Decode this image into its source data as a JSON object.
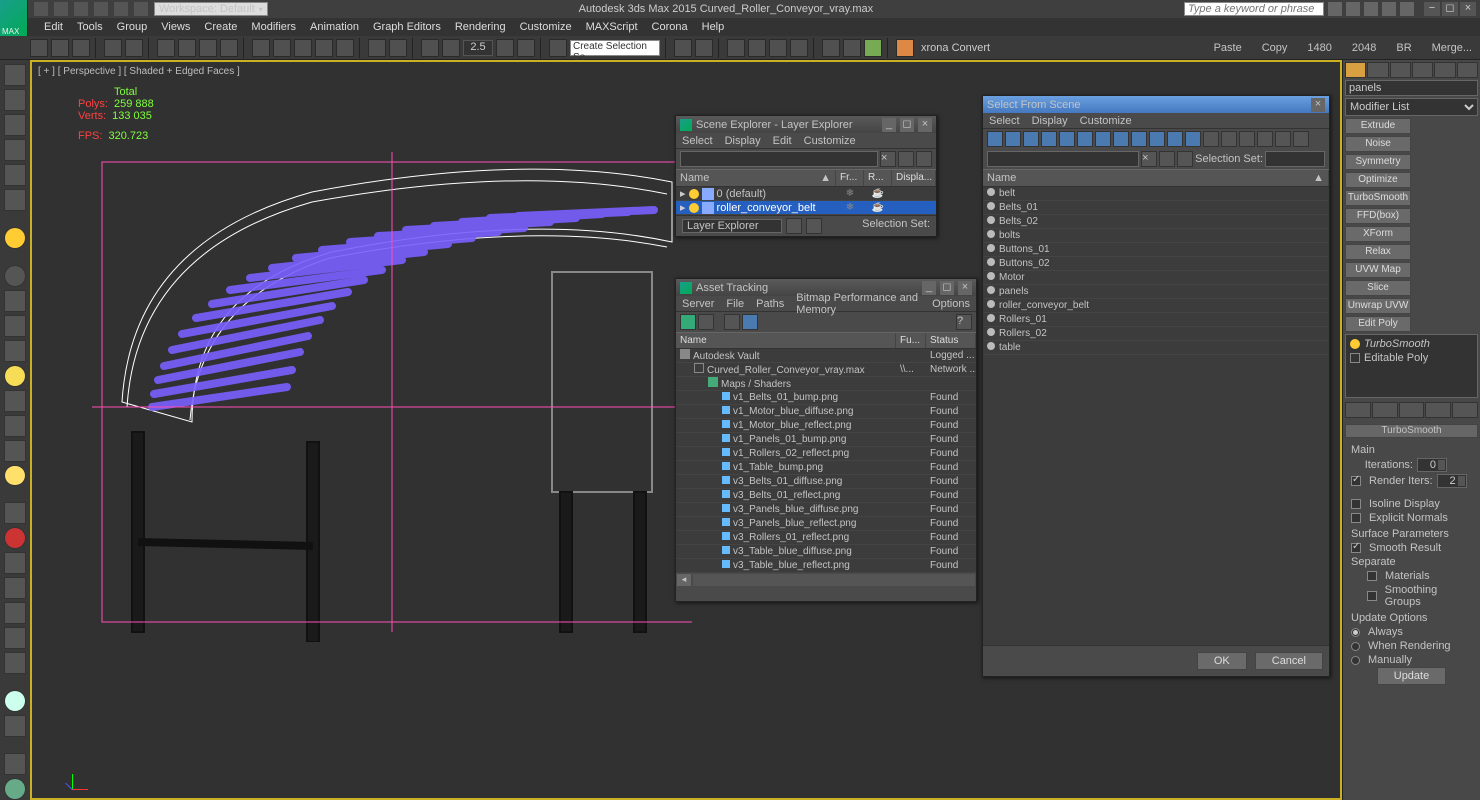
{
  "title_center": "Autodesk 3ds Max 2015     Curved_Roller_Conveyor_vray.max",
  "workspace_combo": "Workspace: Default",
  "search_placeholder": "Type a keyword or phrase",
  "menubar": [
    "Edit",
    "Tools",
    "Group",
    "Views",
    "Create",
    "Modifiers",
    "Animation",
    "Graph Editors",
    "Rendering",
    "Customize",
    "MAXScript",
    "Corona",
    "Help"
  ],
  "toolbar": {
    "spin_val": "2.5",
    "combo": "Create Selection Se",
    "info": [
      "xrona Convert",
      "Paste",
      "Copy",
      "1480",
      "2048",
      "BR",
      "Merge..."
    ]
  },
  "viewport_label": "[ + ] [ Perspective ] [ Shaded + Edged Faces ]",
  "stats": {
    "label_total": "Total",
    "polys_k": "Polys:",
    "polys_v": "259 888",
    "verts_k": "Verts:",
    "verts_v": "133 035",
    "fps_k": "FPS:",
    "fps_v": "320.723"
  },
  "scene_explorer": {
    "title": "Scene Explorer - Layer Explorer",
    "menus": [
      "Select",
      "Display",
      "Edit",
      "Customize"
    ],
    "headers": {
      "name": "Name",
      "fr": "Fr...",
      "r": "R...",
      "disp": "Displa..."
    },
    "rows": [
      {
        "name": "0 (default)",
        "type": "layer",
        "sel": false
      },
      {
        "name": "roller_conveyor_belt",
        "type": "layer",
        "sel": true
      }
    ],
    "footer_combo": "Layer Explorer",
    "footer_lbl": "Selection Set:"
  },
  "asset_tracking": {
    "title": "Asset Tracking",
    "menus": [
      "Server",
      "File",
      "Paths",
      "Bitmap Performance and Memory",
      "Options"
    ],
    "headers": {
      "name": "Name",
      "fu": "Fu...",
      "status": "Status"
    },
    "root": {
      "name": "Autodesk Vault",
      "status": "Logged ..."
    },
    "file": {
      "name": "Curved_Roller_Conveyor_vray.max",
      "fu": "\\\\...",
      "status": "Network ..."
    },
    "folder": "Maps / Shaders",
    "assets": [
      {
        "name": "v1_Belts_01_bump.png",
        "status": "Found"
      },
      {
        "name": "v1_Motor_blue_diffuse.png",
        "status": "Found"
      },
      {
        "name": "v1_Motor_blue_reflect.png",
        "status": "Found"
      },
      {
        "name": "v1_Panels_01_bump.png",
        "status": "Found"
      },
      {
        "name": "v1_Rollers_02_reflect.png",
        "status": "Found"
      },
      {
        "name": "v1_Table_bump.png",
        "status": "Found"
      },
      {
        "name": "v3_Belts_01_diffuse.png",
        "status": "Found"
      },
      {
        "name": "v3_Belts_01_reflect.png",
        "status": "Found"
      },
      {
        "name": "v3_Panels_blue_diffuse.png",
        "status": "Found"
      },
      {
        "name": "v3_Panels_blue_reflect.png",
        "status": "Found"
      },
      {
        "name": "v3_Rollers_01_reflect.png",
        "status": "Found"
      },
      {
        "name": "v3_Table_blue_diffuse.png",
        "status": "Found"
      },
      {
        "name": "v3_Table_blue_reflect.png",
        "status": "Found"
      }
    ]
  },
  "select_from_scene": {
    "title": "Select From Scene",
    "menus": [
      "Select",
      "Display",
      "Customize"
    ],
    "sel_set_lbl": "Selection Set:",
    "headers": {
      "name": "Name"
    },
    "items": [
      "belt",
      "Belts_01",
      "Belts_02",
      "bolts",
      "Buttons_01",
      "Buttons_02",
      "Motor",
      "panels",
      "roller_conveyor_belt",
      "Rollers_01",
      "Rollers_02",
      "table"
    ],
    "ok": "OK",
    "cancel": "Cancel"
  },
  "panel": {
    "objname": "panels",
    "modlist": "Modifier List",
    "buttons": [
      "Extrude",
      "Noise",
      "Symmetry",
      "Optimize",
      "TurboSmooth",
      "FFD(box)",
      "XForm",
      "Relax",
      "UVW Map",
      "Slice",
      "Unwrap UVW",
      "Edit Poly"
    ],
    "stack": [
      {
        "name": "TurboSmooth",
        "italic": true,
        "bulb": true
      },
      {
        "name": "Editable Poly",
        "italic": false,
        "box": true
      }
    ],
    "rollout": "TurboSmooth",
    "main_lbl": "Main",
    "iter_lbl": "Iterations:",
    "iter_v": "0",
    "render_lbl": "Render Iters:",
    "render_v": "2",
    "isoline": "Isoline Display",
    "explicit": "Explicit Normals",
    "surf_lbl": "Surface Parameters",
    "smooth": "Smooth Result",
    "sep_lbl": "Separate",
    "mat": "Materials",
    "sg": "Smoothing Groups",
    "upd_lbl": "Update Options",
    "always": "Always",
    "when_r": "When Rendering",
    "manually": "Manually",
    "update_btn": "Update"
  }
}
